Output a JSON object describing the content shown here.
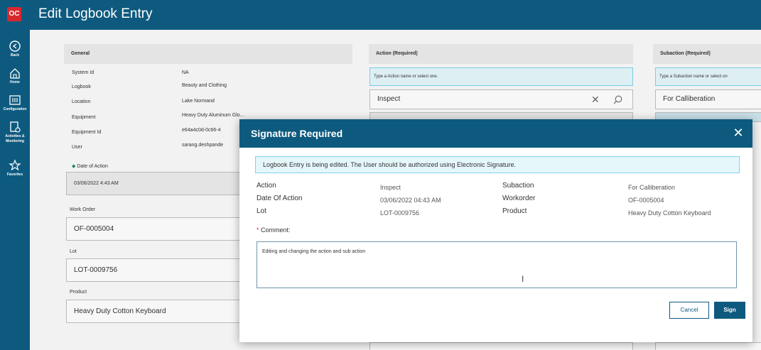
{
  "app": {
    "logo": "OC",
    "title": "Edit Logbook Entry"
  },
  "sidebar": {
    "items": [
      {
        "label": "Back",
        "icon": "back-icon"
      },
      {
        "label": "Home",
        "icon": "home-icon"
      },
      {
        "label": "Configuration",
        "icon": "configuration-icon"
      },
      {
        "label": "Activities & Monitoring",
        "icon": "activities-icon"
      },
      {
        "label": "Favorites",
        "icon": "star-icon"
      }
    ]
  },
  "general": {
    "header": "General",
    "rows": [
      {
        "label": "System Id",
        "value": "NA"
      },
      {
        "label": "Logbook",
        "value": "Beauty and Clothing"
      },
      {
        "label": "Location",
        "value": "Lake Normand"
      },
      {
        "label": "Equipment",
        "value": "Heavy Duty Aluminum Glo..."
      },
      {
        "label": "Equipment Id",
        "value": "e64a4c0d-0c66-4"
      },
      {
        "label": "User",
        "value": "sarang.deshpande"
      }
    ],
    "date_label": "Date of Action",
    "date_value": "03/06/2022 4:43 AM",
    "work_order_label": "Work Order",
    "work_order_value": "OF-0005004",
    "lot_label": "Lot",
    "lot_value": "LOT-0009756",
    "product_label": "Product",
    "product_value": "Heavy Duty Cotton Keyboard"
  },
  "action": {
    "header": "Action (Required)",
    "hint": "Type a Action name or select one.",
    "value": "Inspect"
  },
  "subaction": {
    "header": "Subaction (Required)",
    "hint": "Type a Subaction name or select on",
    "value": "For Calliberation"
  },
  "modal": {
    "title": "Signature Required",
    "banner": "Logbook Entry is being edited. The User should be authorized using Electronic Signature.",
    "details_left": [
      {
        "label": "Action",
        "value": "Inspect"
      },
      {
        "label": "Date Of Action",
        "value": "03/06/2022 04:43 AM"
      },
      {
        "label": "Lot",
        "value": "LOT-0009756"
      }
    ],
    "details_right": [
      {
        "label": "Subaction",
        "value": "For Calliberation"
      },
      {
        "label": "Workorder",
        "value": "OF-0005004"
      },
      {
        "label": "Product",
        "value": "Heavy Duty Cotton Keyboard"
      }
    ],
    "comment_label": "Comment:",
    "comment_value": "Editing and changing the action and sub action",
    "cancel_label": "Cancel",
    "sign_label": "Sign"
  },
  "colors": {
    "primary": "#0e5a7f",
    "danger": "#d8282f",
    "info_bg": "#e6f7fb",
    "info_border": "#7fd4ea"
  }
}
